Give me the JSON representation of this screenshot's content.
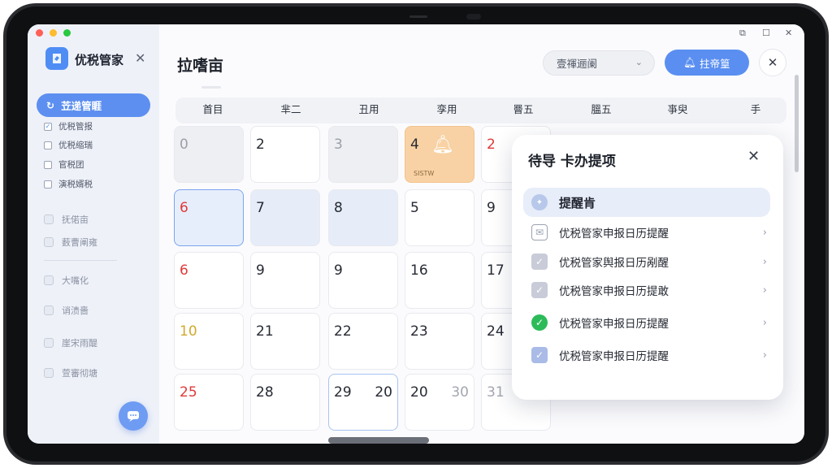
{
  "app": {
    "name": "优税管家",
    "sidebar_close": "✕"
  },
  "sidebar": {
    "active_label": "苙递管睚",
    "sub_items": [
      {
        "label": "优税管报",
        "checked": true
      },
      {
        "label": "优税缩瑞",
        "checked": false
      },
      {
        "label": "官税团",
        "checked": false
      },
      {
        "label": "演税婿税",
        "checked": false
      }
    ],
    "items_a": [
      {
        "label": "抚偌亩"
      },
      {
        "label": "薮曹阐雍"
      }
    ],
    "items_b": [
      {
        "label": "大嘴化"
      },
      {
        "label": "诮渍嗇"
      },
      {
        "label": "崖宋雨醍"
      },
      {
        "label": "萱審彻塘"
      }
    ]
  },
  "header": {
    "title": "拉嗜亩",
    "select_value": "壹禈逦阑",
    "primary_label": "拄帝篁",
    "close_label": "✕"
  },
  "calendar": {
    "weekdays": [
      "首目",
      "芈二",
      "丑用",
      "孪用",
      "罾五",
      "膃五",
      "亊臾",
      "手"
    ],
    "rows": [
      [
        {
          "n": "0",
          "style": "gray"
        },
        {
          "n": "2",
          "style": "white"
        },
        {
          "n": "3",
          "style": "gray"
        },
        {
          "n": "4",
          "style": "orange",
          "note": "SISTW"
        },
        {
          "n": "2",
          "style": "white",
          "tone": "red"
        }
      ],
      [
        {
          "n": "6",
          "style": "selected",
          "tone": "red"
        },
        {
          "n": "7",
          "style": "blue"
        },
        {
          "n": "8",
          "style": "blue"
        },
        {
          "n": "5",
          "style": "white"
        },
        {
          "n": "9",
          "style": "white"
        }
      ],
      [
        {
          "n": "6",
          "style": "white",
          "tone": "red"
        },
        {
          "n": "9",
          "style": "white"
        },
        {
          "n": "9",
          "style": "white"
        },
        {
          "n": "16",
          "style": "white"
        },
        {
          "n": "17",
          "style": "white"
        }
      ],
      [
        {
          "n": "10",
          "style": "white",
          "tone": "yellow"
        },
        {
          "n": "21",
          "style": "white"
        },
        {
          "n": "22",
          "style": "white"
        },
        {
          "n": "23",
          "style": "white"
        },
        {
          "n": "24",
          "style": "white"
        }
      ],
      [
        {
          "n": "25",
          "style": "white",
          "tone": "red"
        },
        {
          "n": "28",
          "style": "white"
        },
        {
          "n": "29",
          "n2": "20",
          "style": "outlined"
        },
        {
          "n": "20",
          "n2": "30",
          "style": "white"
        },
        {
          "n": "31",
          "style": "white",
          "tone": "light"
        }
      ]
    ]
  },
  "popup": {
    "title": "待导 卡办提项",
    "close": "✕",
    "active_label": "提醒肯",
    "rows": [
      {
        "label": "优税管家申报日历提醒",
        "icon": "mail"
      },
      {
        "label": "优税管家舆报日历剐醒",
        "icon": "checkgray"
      },
      {
        "label": "优税管家申报日历提敢",
        "icon": "checkgray"
      },
      {
        "label": "优税管家申报日历提醒",
        "icon": "green"
      },
      {
        "label": "优税管家申报日历提醒",
        "icon": "checkblue"
      }
    ]
  },
  "colors": {
    "accent": "#5a8ff1",
    "highlight_orange": "#f8d2a4",
    "weekend_red": "#de3a3a"
  }
}
